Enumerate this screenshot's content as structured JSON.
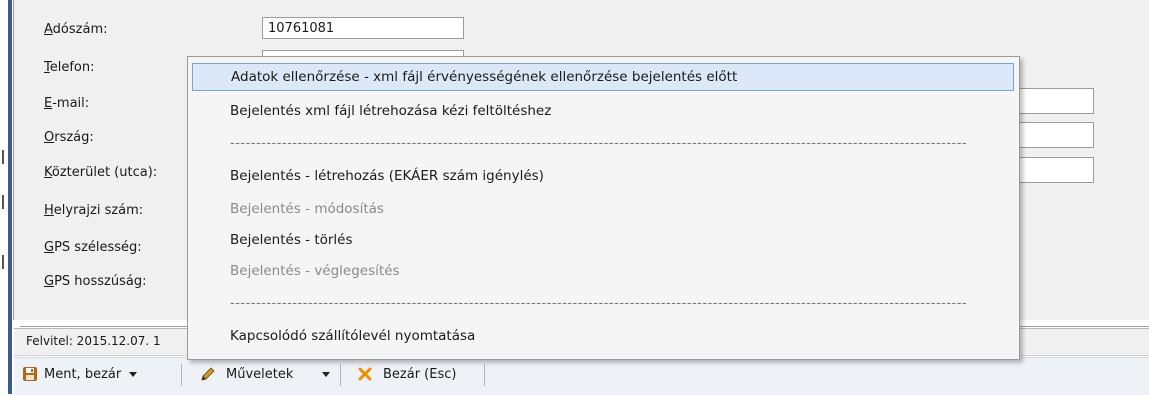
{
  "form": {
    "fields": [
      {
        "label_underline": "A",
        "label_rest": "dószám:",
        "value": "10761081"
      },
      {
        "label_underline": "T",
        "label_rest": "elefon:",
        "value": ""
      },
      {
        "label_underline": "E",
        "label_rest": "-mail:",
        "value": ""
      },
      {
        "label_underline": "O",
        "label_rest": "rszág:",
        "value": ""
      },
      {
        "label_underline": "K",
        "label_rest": "özterület (utca):",
        "value": ""
      },
      {
        "label_underline": "H",
        "label_rest": "elyrajzi szám:",
        "value": ""
      },
      {
        "label_underline": "G",
        "label_rest": "PS szélesség:",
        "value": ""
      },
      {
        "label_underline": "G",
        "label_rest": "PS hosszúság:",
        "value": ""
      }
    ]
  },
  "status": {
    "text": "Felvitel: 2015.12.07. 1"
  },
  "toolbar": {
    "save_label": "Ment, bezár",
    "actions_label": "Műveletek",
    "close_label": "Bezár (Esc)"
  },
  "menu": {
    "items": [
      "Adatok ellenőrzése - xml fájl érvényességének ellenőrzése bejelentés előtt",
      "Bejelentés xml fájl létrehozása kézi feltöltéshez",
      "Bejelentés - létrehozás (EKÁER szám igénylés)",
      "Bejelentés - módosítás",
      "Bejelentés - törlés",
      "Bejelentés - véglegesítés",
      "Kapcsolódó szállítólevél nyomtatása"
    ],
    "separator": "----------------------------------------------------------------------------------------------------------------------------------------------"
  },
  "colors": {
    "highlight": "#dbe8f8",
    "accent": "#3d5a8a",
    "close_icon": "#f08c00",
    "pencil_icon": "#c89b2c",
    "save_icon": "#b0651c"
  }
}
